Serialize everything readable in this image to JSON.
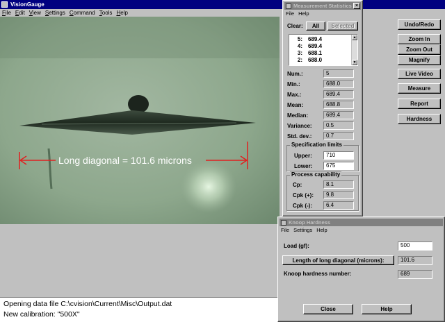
{
  "app": {
    "title": "VisionGauge"
  },
  "main_menu": [
    "File",
    "Edit",
    "View",
    "Settings",
    "Command",
    "Tools",
    "Help"
  ],
  "image_overlay": {
    "annotation": "Long diagonal = 101.6 microns",
    "line_color": "#e02020"
  },
  "status_lines": [
    "Opening data file C:\\cvision\\Current\\Misc\\Output.dat",
    "New calibration: \"500X\""
  ],
  "toolbar_buttons": [
    "Undo/Redo",
    "Zoom In",
    "Zoom Out",
    "Magnify",
    "Live Video",
    "Measure",
    "Report",
    "Hardness"
  ],
  "stats_window": {
    "title": "Measurement Statistics",
    "menu": [
      "File",
      "Help"
    ],
    "clear_label": "Clear:",
    "all_button": "All",
    "selected_button": "Selected",
    "list": [
      {
        "n": "5:",
        "v": "689.4"
      },
      {
        "n": "4:",
        "v": "689.4"
      },
      {
        "n": "3:",
        "v": "688.1"
      },
      {
        "n": "2:",
        "v": "688.0"
      }
    ],
    "stats": [
      {
        "label": "Num.:",
        "value": "5"
      },
      {
        "label": "Min.:",
        "value": "688.0"
      },
      {
        "label": "Max.:",
        "value": "689.4"
      },
      {
        "label": "Mean:",
        "value": "688.8"
      },
      {
        "label": "Median:",
        "value": "689.4"
      },
      {
        "label": "Variance:",
        "value": "0.5"
      },
      {
        "label": "Std. dev.:",
        "value": "0.7"
      }
    ],
    "spec": {
      "title": "Specification limits",
      "upper_label": "Upper:",
      "upper_value": "710",
      "lower_label": "Lower:",
      "lower_value": "675"
    },
    "process": {
      "title": "Process capability",
      "rows": [
        {
          "label": "Cp:",
          "value": "8.1"
        },
        {
          "label": "Cpk (+):",
          "value": "9.8"
        },
        {
          "label": "Cpk (-):",
          "value": "6.4"
        }
      ]
    }
  },
  "knoop_window": {
    "title": "Knoop Hardness",
    "menu": [
      "File",
      "Settings",
      "Help"
    ],
    "load_label": "Load (gf):",
    "load_value": "500",
    "diag_button": "Length of long diagonal (microns):",
    "diag_value": "101.6",
    "hardness_label": "Knoop hardness number:",
    "hardness_value": "689",
    "close_button": "Close",
    "help_button": "Help"
  }
}
